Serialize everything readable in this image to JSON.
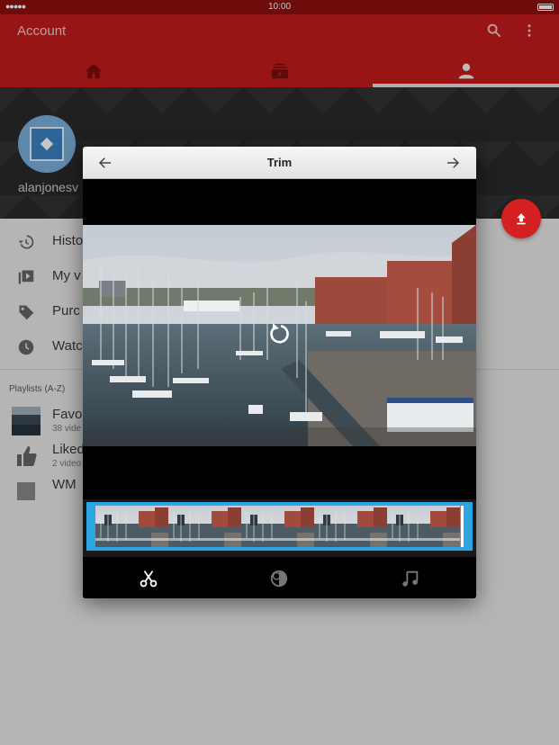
{
  "status_bar": {
    "signal": "●●●●●",
    "time": "10:00"
  },
  "app_bar": {
    "title": "Account",
    "icons": [
      "search-icon",
      "more-vert-icon"
    ],
    "tabs": [
      {
        "name": "home",
        "icon": "home-icon"
      },
      {
        "name": "subscriptions",
        "icon": "subscriptions-icon"
      },
      {
        "name": "account",
        "icon": "account-icon",
        "selected": true
      }
    ]
  },
  "channel": {
    "username": "alanjonesv"
  },
  "menu": {
    "items": [
      {
        "label": "Histo",
        "icon": "history-icon"
      },
      {
        "label": "My v",
        "icon": "my-videos-icon"
      },
      {
        "label": "Purc",
        "icon": "purchases-icon"
      },
      {
        "label": "Watc",
        "icon": "watch-later-icon"
      }
    ]
  },
  "playlists": {
    "header": "Playlists (A-Z)",
    "items": [
      {
        "name": "Favo",
        "count": "38 vide"
      },
      {
        "name": "Liked",
        "count": "2 video"
      },
      {
        "name": "WM",
        "count": ""
      }
    ]
  },
  "dialog": {
    "title": "Trim",
    "tools": [
      "scissors-icon",
      "filters-icon",
      "music-note-icon"
    ]
  },
  "colors": {
    "app_bar": "#c41a1a",
    "status_bar": "#8e0f0f",
    "fab": "#d42020",
    "timeline_accent": "#2ba6e3"
  }
}
